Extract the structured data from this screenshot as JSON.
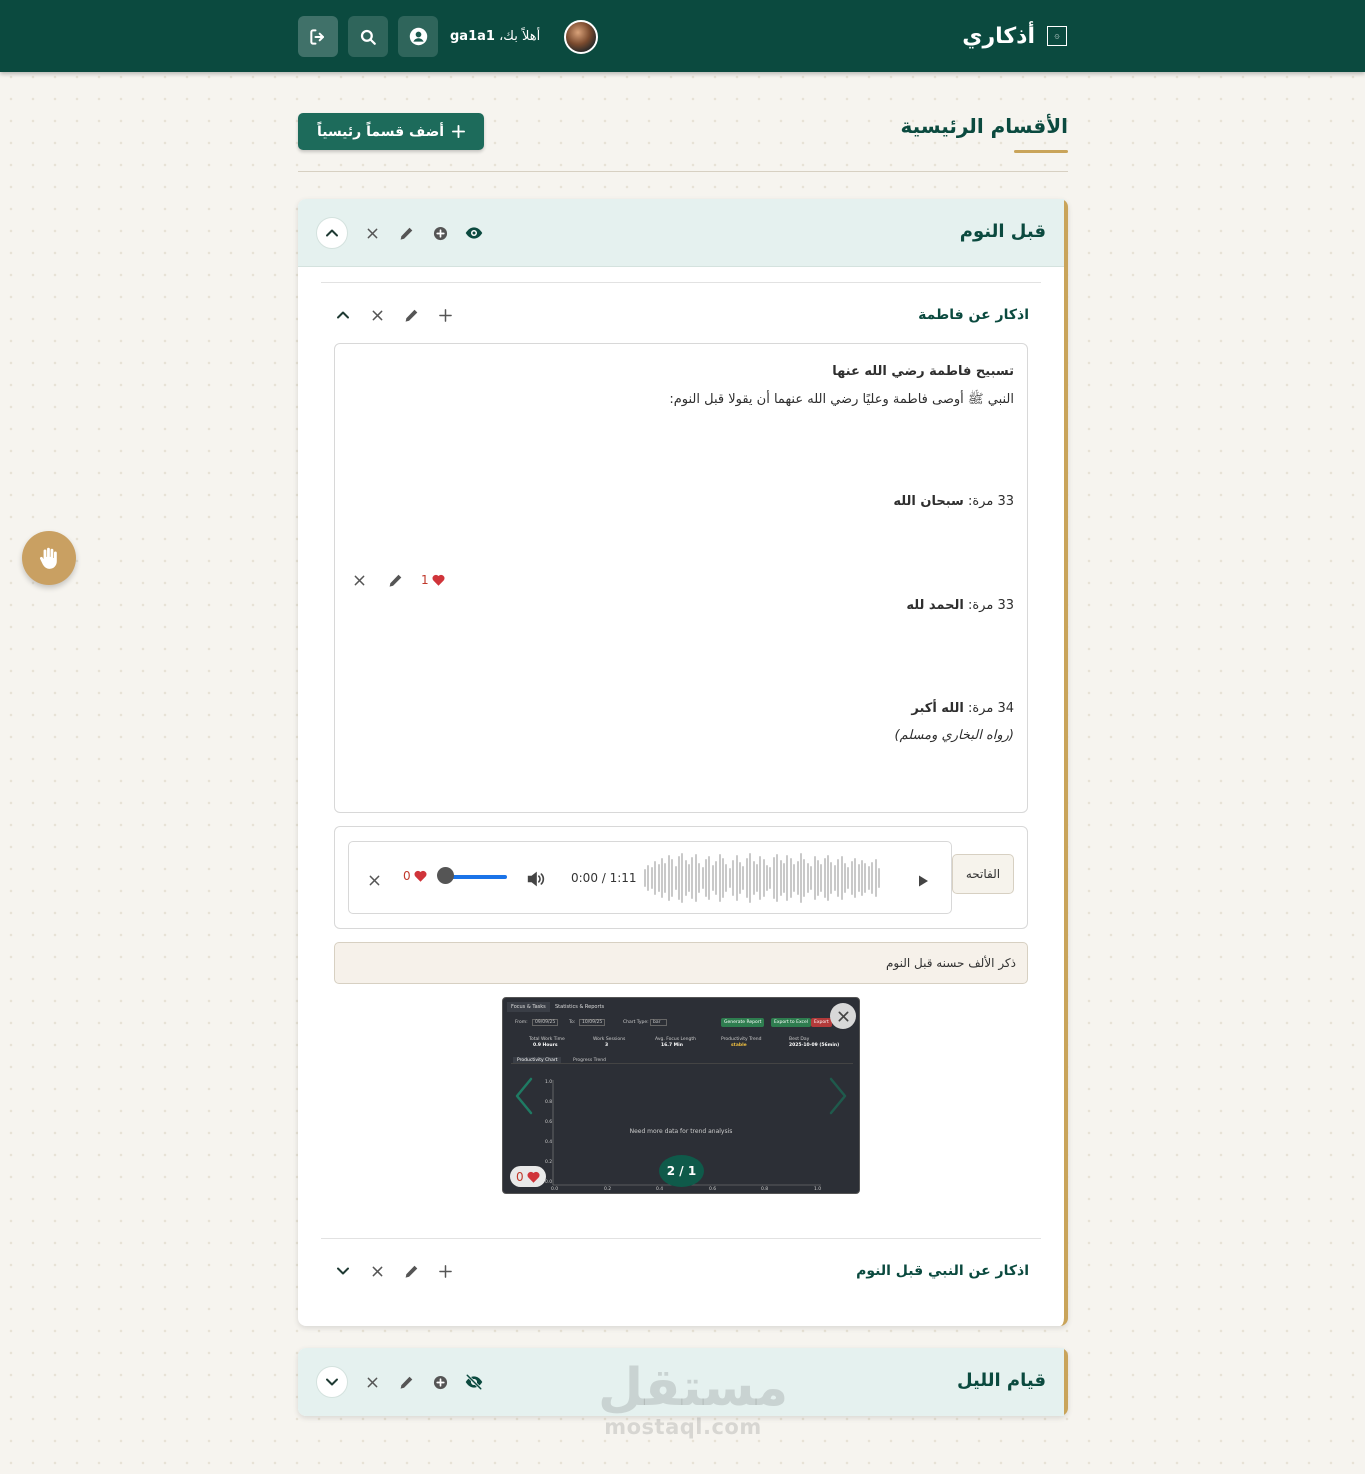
{
  "header": {
    "app_title": "أذكاري",
    "logo_text": "۞",
    "greeting_prefix": "أهلاً بك،",
    "username": "ga1a1",
    "icons": [
      "logout-icon",
      "search-icon",
      "user-circle-icon"
    ]
  },
  "page": {
    "title": "الأقسام الرئيسية",
    "add_main_button": "أضف قسماً رئيسياً"
  },
  "sections": [
    {
      "title": "قبل النوم",
      "expanded": true,
      "visible": true,
      "subsections": [
        {
          "title": "اذكار عن فاطمة",
          "expanded": true,
          "zikr": {
            "title": "تسبيح فاطمة رضي الله عنها",
            "intro": "النبي ﷺ أوصى فاطمة وعليًا رضي الله عنهما أن يقولا قبل النوم:",
            "lines": [
              {
                "count": "33 مرة:",
                "text": "سبحان الله"
              },
              {
                "count": "33 مرة:",
                "text": "الحمد لله"
              },
              {
                "count": "34 مرة:",
                "text": "الله أكبر"
              }
            ],
            "source": "(رواه البخاري ومسلم)",
            "likes": "1"
          },
          "audio": {
            "label": "الفاتحه",
            "time": "0:00 / 1:11",
            "likes": "0",
            "volume": 0.0
          },
          "note": "ذكر الألف حسنه قبل النوم",
          "image_viewer": {
            "counter": "1 / 2",
            "likes": "0",
            "screenshot": {
              "tabs": [
                "Focus & Tasks",
                "Statistics & Reports"
              ],
              "from_label": "From:",
              "from_value": "09/09/25",
              "to_label": "To:",
              "to_value": "10/09/25",
              "chart_type_label": "Chart Type:",
              "chart_type_value": "bar",
              "buttons": [
                "Generate Report",
                "Export to Excel",
                "Export"
              ],
              "stats": [
                {
                  "label": "Total Work Time",
                  "value": "0.9 Hours"
                },
                {
                  "label": "Work Sessions",
                  "value": "3"
                },
                {
                  "label": "Avg. Focus Length",
                  "value": "16.7 Min"
                },
                {
                  "label": "Productivity Trend",
                  "value": "stable"
                },
                {
                  "label": "Best Day",
                  "value": "2025-10-09 (56min)"
                }
              ],
              "subtabs": [
                "Productivity Chart",
                "Progress Trend"
              ],
              "message": "Need more data for trend analysis",
              "y_ticks": [
                "1.0",
                "0.8",
                "0.6",
                "0.4",
                "0.2",
                "0.0"
              ],
              "x_ticks": [
                "0.0",
                "0.2",
                "0.4",
                "0.6",
                "0.8",
                "1.0"
              ]
            }
          }
        },
        {
          "title": "اذكار عن النبي قبل النوم",
          "expanded": false
        }
      ]
    },
    {
      "title": "قيام الليل",
      "expanded": false,
      "visible": false
    }
  ],
  "watermark": {
    "arabic": "مستقل",
    "latin": "mostaql.com"
  },
  "colors": {
    "header": "#0b4a3f",
    "accent_gold": "#c9a45a",
    "primary_button": "#1d6b5b",
    "like_red": "#c0392b"
  }
}
